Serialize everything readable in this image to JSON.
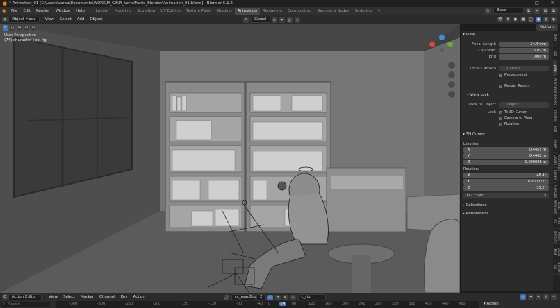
{
  "title_bar": {
    "text": "* Animation_01 [C:\\Users\\zarab\\Documents\\WORK\\Pi_Git\\Pi_Verte\\Nerio_Blender\\Animation_01.blend] - Blender 5.1.2",
    "minimize": "—",
    "maximize": "□",
    "close": "✕"
  },
  "menu": {
    "items": [
      "File",
      "Edit",
      "Render",
      "Window",
      "Help"
    ],
    "workspaces": [
      "Layout",
      "Modeling",
      "Sculpting",
      "UV Editing",
      "Texture Paint",
      "Shading",
      "Animation",
      "Rendering",
      "Compositing",
      "Geometry Nodes",
      "Scripting"
    ],
    "active_workspace": "Animation",
    "add_workspace": "+",
    "scene": "Base"
  },
  "viewport_header": {
    "mode": "Object Mode",
    "menus": [
      "View",
      "Select",
      "Add",
      "Object"
    ],
    "orientation": "Global",
    "options": "Options"
  },
  "viewport": {
    "perspective": "User Perspective",
    "object_info": "(74) character | cc_rig"
  },
  "npanel": {
    "tabs": [
      "Item",
      "Tool",
      "View",
      "Animation",
      "BlenRig",
      "Transfer",
      "Edit",
      "Rigify",
      "Animation Layers",
      "Create",
      "HairOps",
      "Node Wrangler",
      "Auto Rig",
      "Mesh Deform",
      "Voxel Heat",
      "Blender Kit"
    ],
    "active_tab": "View",
    "view": {
      "header": "View",
      "focal_length_label": "Focal Length",
      "focal_length": "24.4 mm",
      "clip_start_label": "Clip Start",
      "clip_start": "0.01 m",
      "clip_end_label": "End",
      "clip_end": "1000 m",
      "local_camera_label": "Local Camera",
      "local_camera": "Camera",
      "passepartout_label": "Passepartout",
      "render_region_label": "Render Region"
    },
    "view_lock": {
      "header": "View Lock",
      "lock_to_object_label": "Lock to Object",
      "lock_to_object_placeholder": "Object",
      "lock_label": "Lock",
      "to_3d_cursor": "To 3D Cursor",
      "camera_to_view": "Camera to View",
      "rotation": "Rotation"
    },
    "cursor": {
      "header": "3D Cursor",
      "location_label": "Location:",
      "x_label": "X",
      "x": "0.4455 m",
      "y_label": "Y",
      "y": "0.4442 m",
      "z_label": "Z",
      "z": "0.000028 m",
      "rotation_label": "Rotation:",
      "rx": "46.4°",
      "ry": "0.000077°",
      "rz": "-35.2°",
      "mode": "XYZ Euler"
    },
    "collections": "Collections",
    "annotations": "Annotations"
  },
  "timeline": {
    "editor": "Action Editor",
    "menus": [
      "View",
      "Select",
      "Marker",
      "Channel",
      "Key",
      "Action"
    ],
    "action": "cc_readBook",
    "slot_count": "2",
    "rig": "c_rig",
    "search_placeholder": "Search",
    "ruler": [
      "-360",
      "-300",
      "-250",
      "-200",
      "-150",
      "-120",
      "-80",
      "-40",
      "0",
      "74",
      "80",
      "120",
      "160",
      "200",
      "240",
      "280",
      "320",
      "360",
      "400",
      "440",
      "480"
    ],
    "current_frame": "74",
    "right_header": "Action"
  },
  "colors": {
    "accent": "#4772b3",
    "active_tab": "#4a4a4a",
    "frame_marker": "#4772b3"
  }
}
